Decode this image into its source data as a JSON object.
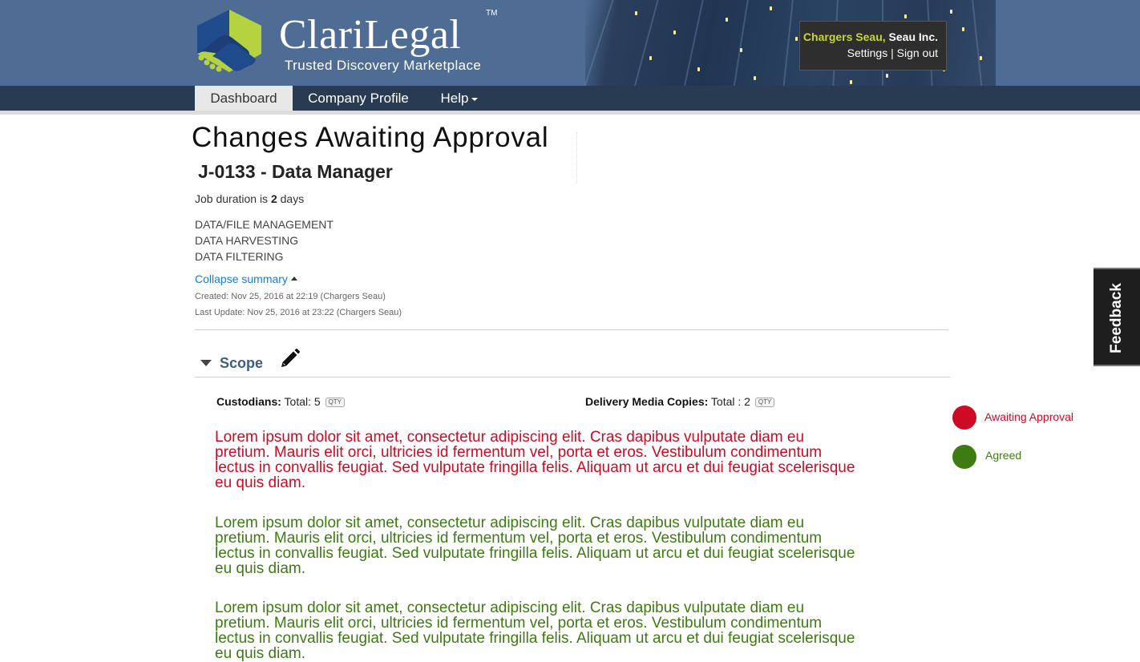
{
  "brand": {
    "name": "ClariLegal",
    "trademark": "TM",
    "tagline": "Trusted Discovery Marketplace"
  },
  "user": {
    "name": "Chargers Seau,",
    "company": "Seau Inc.",
    "settings_label": "Settings",
    "separator": "|",
    "signout_label": "Sign out"
  },
  "nav": {
    "dashboard": "Dashboard",
    "company_profile": "Company Profile",
    "help": "Help"
  },
  "page": {
    "title": "Changes Awaiting Approval",
    "job_title": "J-0133 - Data Manager",
    "duration_prefix": "Job duration is",
    "duration_value": "2",
    "duration_suffix": "days",
    "services": [
      "DATA/FILE MANAGEMENT",
      "DATA HARVESTING",
      "DATA FILTERING"
    ],
    "collapse_label": "Collapse summary",
    "created": "Created: Nov 25, 2016 at 22:19 (Chargers Seau)",
    "last_update": "Last Update: Nov 25, 2016 at 23:22 (Chargers Seau)"
  },
  "scope": {
    "label": "Scope",
    "custodians_label": "Custodians:",
    "custodians_value": "Total: 5",
    "delivery_label": "Delivery Media Copies:",
    "delivery_value": "Total : 2",
    "qty_badge": "QTY",
    "paragraphs": [
      {
        "status": "awaiting",
        "text": "Lorem ipsum dolor sit amet, consectetur adipiscing elit. Cras dapibus vulputate diam eu pretium. Mauris elit orci, ultricies id fermentum vel, porta et eros. Vestibulum condimentum lectus in convallis feugiat. Sed vulputate fringilla felis. Aliquam ut arcu et dui feugiat scelerisque eu quis diam."
      },
      {
        "status": "agreed",
        "text": "Lorem ipsum dolor sit amet, consectetur adipiscing elit. Cras dapibus vulputate diam eu pretium. Mauris elit orci, ultricies id fermentum vel, porta et eros. Vestibulum condimentum lectus in convallis feugiat. Sed vulputate fringilla felis. Aliquam ut arcu et dui feugiat scelerisque eu quis diam."
      },
      {
        "status": "agreed",
        "text": "Lorem ipsum dolor sit amet, consectetur adipiscing elit. Cras dapibus vulputate diam eu pretium. Mauris elit orci, ultricies id fermentum vel, porta et eros. Vestibulum condimentum lectus in convallis feugiat. Sed vulputate fringilla felis. Aliquam ut arcu et dui feugiat scelerisque eu quis diam."
      }
    ]
  },
  "legend": {
    "awaiting_label": "Awaiting Approval",
    "agreed_label": "Agreed"
  },
  "feedback_label": "Feedback",
  "colors": {
    "awaiting": "#cf0a25",
    "agreed": "#3e7b12",
    "header_bg": "#4f6d94",
    "nav_bg": "#293b52",
    "link": "#1a7bc7",
    "user_name": "#c4d636"
  }
}
